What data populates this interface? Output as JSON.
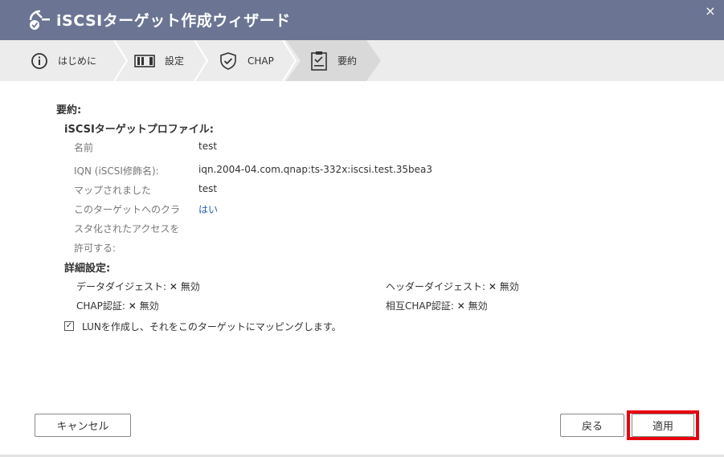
{
  "window": {
    "title": "iSCSIターゲット作成ウィザード",
    "close_symbol": "×"
  },
  "steps": [
    {
      "label": "はじめに",
      "icon": "info-icon"
    },
    {
      "label": "設定",
      "icon": "settings-panel-icon"
    },
    {
      "label": "CHAP",
      "icon": "shield-check-icon"
    },
    {
      "label": "要約",
      "icon": "clipboard-check-icon"
    }
  ],
  "summary": {
    "heading": "要約:",
    "profile_heading": "iSCSIターゲットプロファイル:",
    "rows": [
      {
        "label": "名前",
        "value": "test"
      },
      {
        "label": "IQN (iSCSI修飾名):",
        "value": "iqn.2004-04.com.qnap:ts-332x:iscsi.test.35bea3"
      },
      {
        "label": "マップされました",
        "value": "test"
      }
    ],
    "cluster_label_lines": [
      "このターゲットへのクラ",
      "スタ化されたアクセスを",
      "許可する:"
    ],
    "cluster_value": "はい",
    "advanced_heading": "詳細設定:",
    "advanced": [
      {
        "label": "データダイジェスト:",
        "mark": "✕",
        "value": "無効"
      },
      {
        "label": "ヘッダーダイジェスト:",
        "mark": "✕",
        "value": "無効"
      },
      {
        "label": "CHAP認証:",
        "mark": "✕",
        "value": "無効"
      },
      {
        "label": "相互CHAP認証:",
        "mark": "✕",
        "value": "無効"
      }
    ],
    "lun_check_mark": "✓",
    "lun_text": "LUNを作成し、それをこのターゲットにマッピングします。"
  },
  "footer": {
    "cancel": "キャンセル",
    "back": "戻る",
    "apply": "適用"
  },
  "colors": {
    "titlebar": "#6b7593",
    "highlight": "#e8000f",
    "link": "#2a5db0"
  }
}
